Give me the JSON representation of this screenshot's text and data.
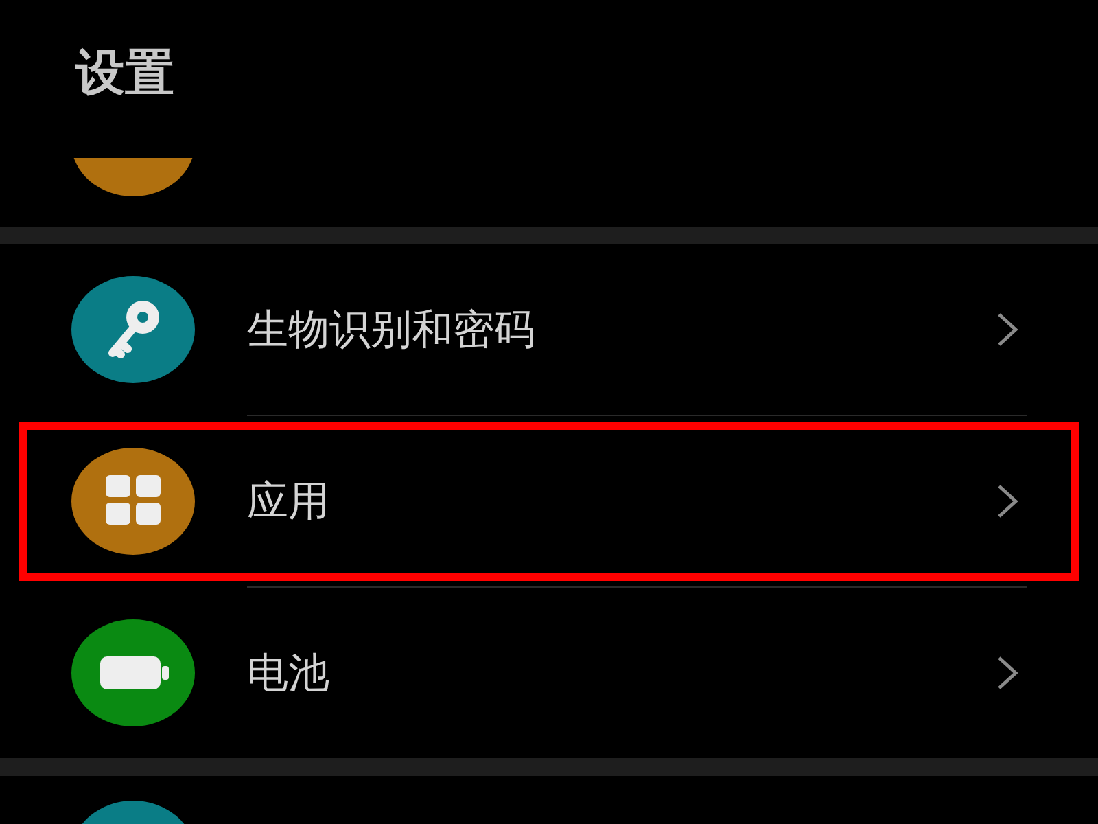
{
  "title": "设置",
  "sections": [
    {
      "items": [
        {
          "kind": "partial-bottom",
          "color": "#b0700f"
        }
      ]
    },
    {
      "items": [
        {
          "kind": "key",
          "color": "#0a7d86",
          "label": "生物识别和密码",
          "highlighted": false
        },
        {
          "kind": "apps",
          "color": "#b0700f",
          "label": "应用",
          "highlighted": true
        },
        {
          "kind": "battery",
          "color": "#0a8a12",
          "label": "电池",
          "highlighted": false
        }
      ]
    },
    {
      "items": [
        {
          "kind": "partial-top",
          "color": "#0a7d86"
        }
      ]
    }
  ]
}
